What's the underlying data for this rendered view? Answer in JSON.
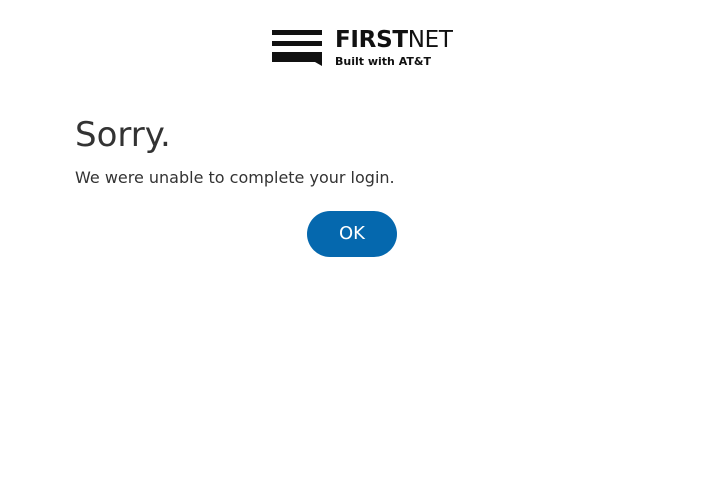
{
  "header": {
    "logo_icon": "firstnet-logo-mark",
    "logo_bold": "FIRST",
    "logo_thin": "NET",
    "logo_tagline": "Built with AT&T"
  },
  "main": {
    "title": "Sorry.",
    "message": "We were unable to complete your login.",
    "ok_label": "OK"
  },
  "colors": {
    "button_bg": "#0568ae",
    "button_text": "#ffffff",
    "text": "#333333",
    "logo": "#111111"
  }
}
